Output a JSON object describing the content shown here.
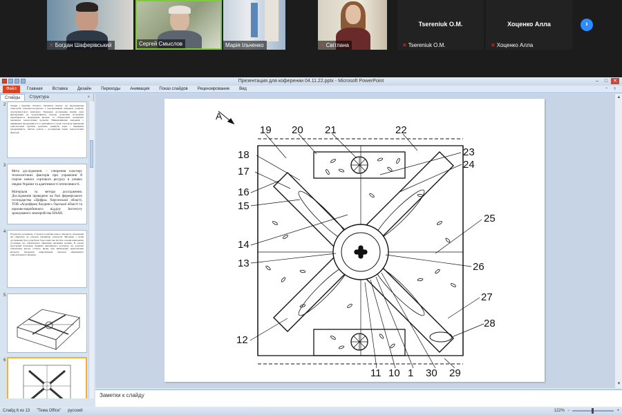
{
  "video": {
    "participants": [
      {
        "name": "Богдан Шаферівський",
        "muted": true
      },
      {
        "name": "Сергей Смыслов",
        "muted": false
      },
      {
        "name": "Марія Ільченко",
        "muted": false
      },
      {
        "name": "Світлана",
        "muted": true
      },
      {
        "name": "Tsereniuk O.M.",
        "muted": true
      },
      {
        "name": "Хоценко Алла",
        "muted": true
      }
    ],
    "dark_tiles": [
      {
        "big_name": "Tsereniuk O.M."
      },
      {
        "big_name": "Хоценко Алла"
      }
    ],
    "next_label": "›",
    "mic_icon": "mic-off-icon"
  },
  "window": {
    "title": "Презентация для коферении 04.11.22.pptx  -  Microsoft PowerPoint",
    "controls": [
      "–",
      "□",
      "✕"
    ]
  },
  "ribbon": {
    "file_tab": "Файл",
    "tabs": [
      "Главная",
      "Вставка",
      "Дизайн",
      "Переходы",
      "Анимация",
      "Показ слайдов",
      "Рецензирование",
      "Вид"
    ],
    "right_icons": "⌃ ?"
  },
  "panel": {
    "tabs": [
      "Слайды",
      "Структура"
    ],
    "close": "×",
    "slide2_text": "Теория і практика світового сівозмінах показує, що впровадження технологій сільськогосподарства є перспективним напрямом розвитку агропромислового комплексу. Проведені дослідження впливу умов вирощування на продуктивність культур дозволили встановити закономірності формування врожаю та обґрунтувати оптимальні параметри технологічних процесів. Найважливішим завданням є підвищення продуктивності та адаптивності сортів. Своєчасне вирішення технологічних проблем дозволить уникнути втрат і підвищити продуктивність. Метою роботи є дослідження нових технологічних факторів.",
    "slide3_goal": "Мета дослідження. – створення кластеру технологічних факторів при управлінні й гоцією нового сортового ресурсу в умовах півдня України та адаптивності інтенсивності.",
    "slide3_materials": "Матеріали та методи дослідження. Дослідження проведено на базі фермерського господарства «Цифра» Херсонської області, ТОВ «Агрофірма Холдинг» Одеської області та науково-виробничого відділу Інституту зрошуваного землеробства НААН.",
    "slide4_text": "Результати досліджень. У процесі розробки нового сівального обладнання ми спирались на ключові параметри технології. Виходячи з цілей дослідження було розроблено блок-схему, яка містить основні компоненти установки, що забезпечують ефективне висівання насіння. В основу конструкції покладено принцип рівномірного розподілу, що дозволяє забезпечити високу точність висіву при мінімальних енергетичних витратах. Проведені випробування показали ефективність запропонованого рішення.",
    "numbers": [
      "2",
      "3",
      "4",
      "5",
      "6"
    ]
  },
  "slide": {
    "view_label": "A",
    "callouts": [
      "19",
      "20",
      "21",
      "22",
      "23",
      "24",
      "18",
      "17",
      "16",
      "15",
      "25",
      "14",
      "13",
      "26",
      "27",
      "28",
      "12",
      "11",
      "10",
      "1",
      "30",
      "29"
    ]
  },
  "notes": {
    "placeholder": "Заметки к слайду"
  },
  "status": {
    "slide_info": "Слайд 6 из 13",
    "theme": "\"Тема Office\"",
    "language": "русский",
    "zoom": "122%"
  }
}
